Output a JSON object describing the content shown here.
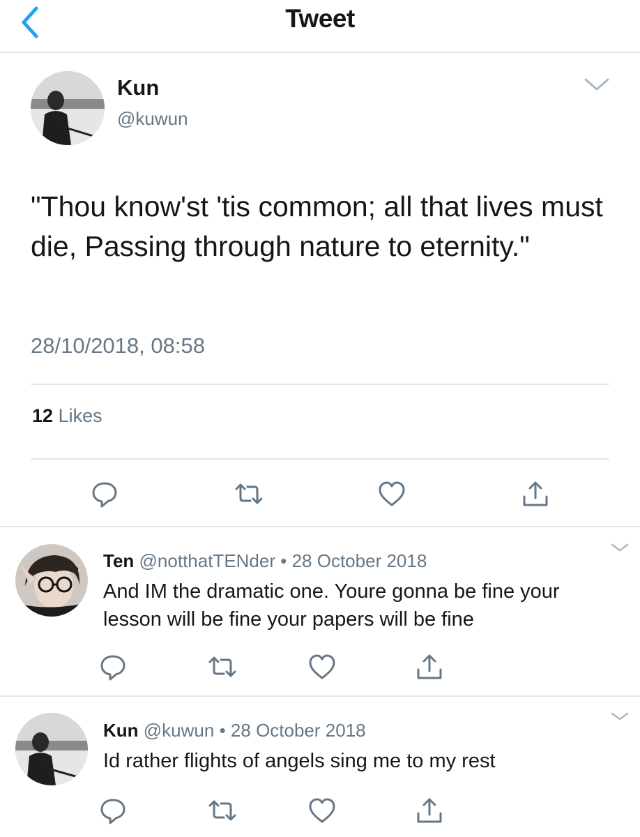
{
  "header": {
    "title": "Tweet",
    "back_icon": "chevron-left-icon",
    "accent": "#1da1f2"
  },
  "main_tweet": {
    "author_name": "Kun",
    "author_handle": "@kuwun",
    "text": "\"Thou know'st 'tis common; all that lives must die, Passing through nature to eternity.\"",
    "timestamp": "28/10/2018, 08:58",
    "likes_count": "12",
    "likes_label": "Likes",
    "actions": [
      "reply-icon",
      "retweet-icon",
      "like-icon",
      "share-icon"
    ]
  },
  "replies": [
    {
      "author_name": "Ten",
      "author_handle": "@notthatTENder",
      "separator": "•",
      "date": "28 October 2018",
      "text": "And IM the dramatic one. Youre gonna be fine your lesson will be fine your papers will be fine"
    },
    {
      "author_name": "Kun",
      "author_handle": "@kuwun",
      "separator": "•",
      "date": "28 October 2018",
      "text": "Id rather flights of angels sing me to my rest"
    }
  ],
  "colors": {
    "text": "#14171a",
    "secondary": "#657786",
    "divider": "#e1e8ed",
    "icon": "#657786"
  }
}
